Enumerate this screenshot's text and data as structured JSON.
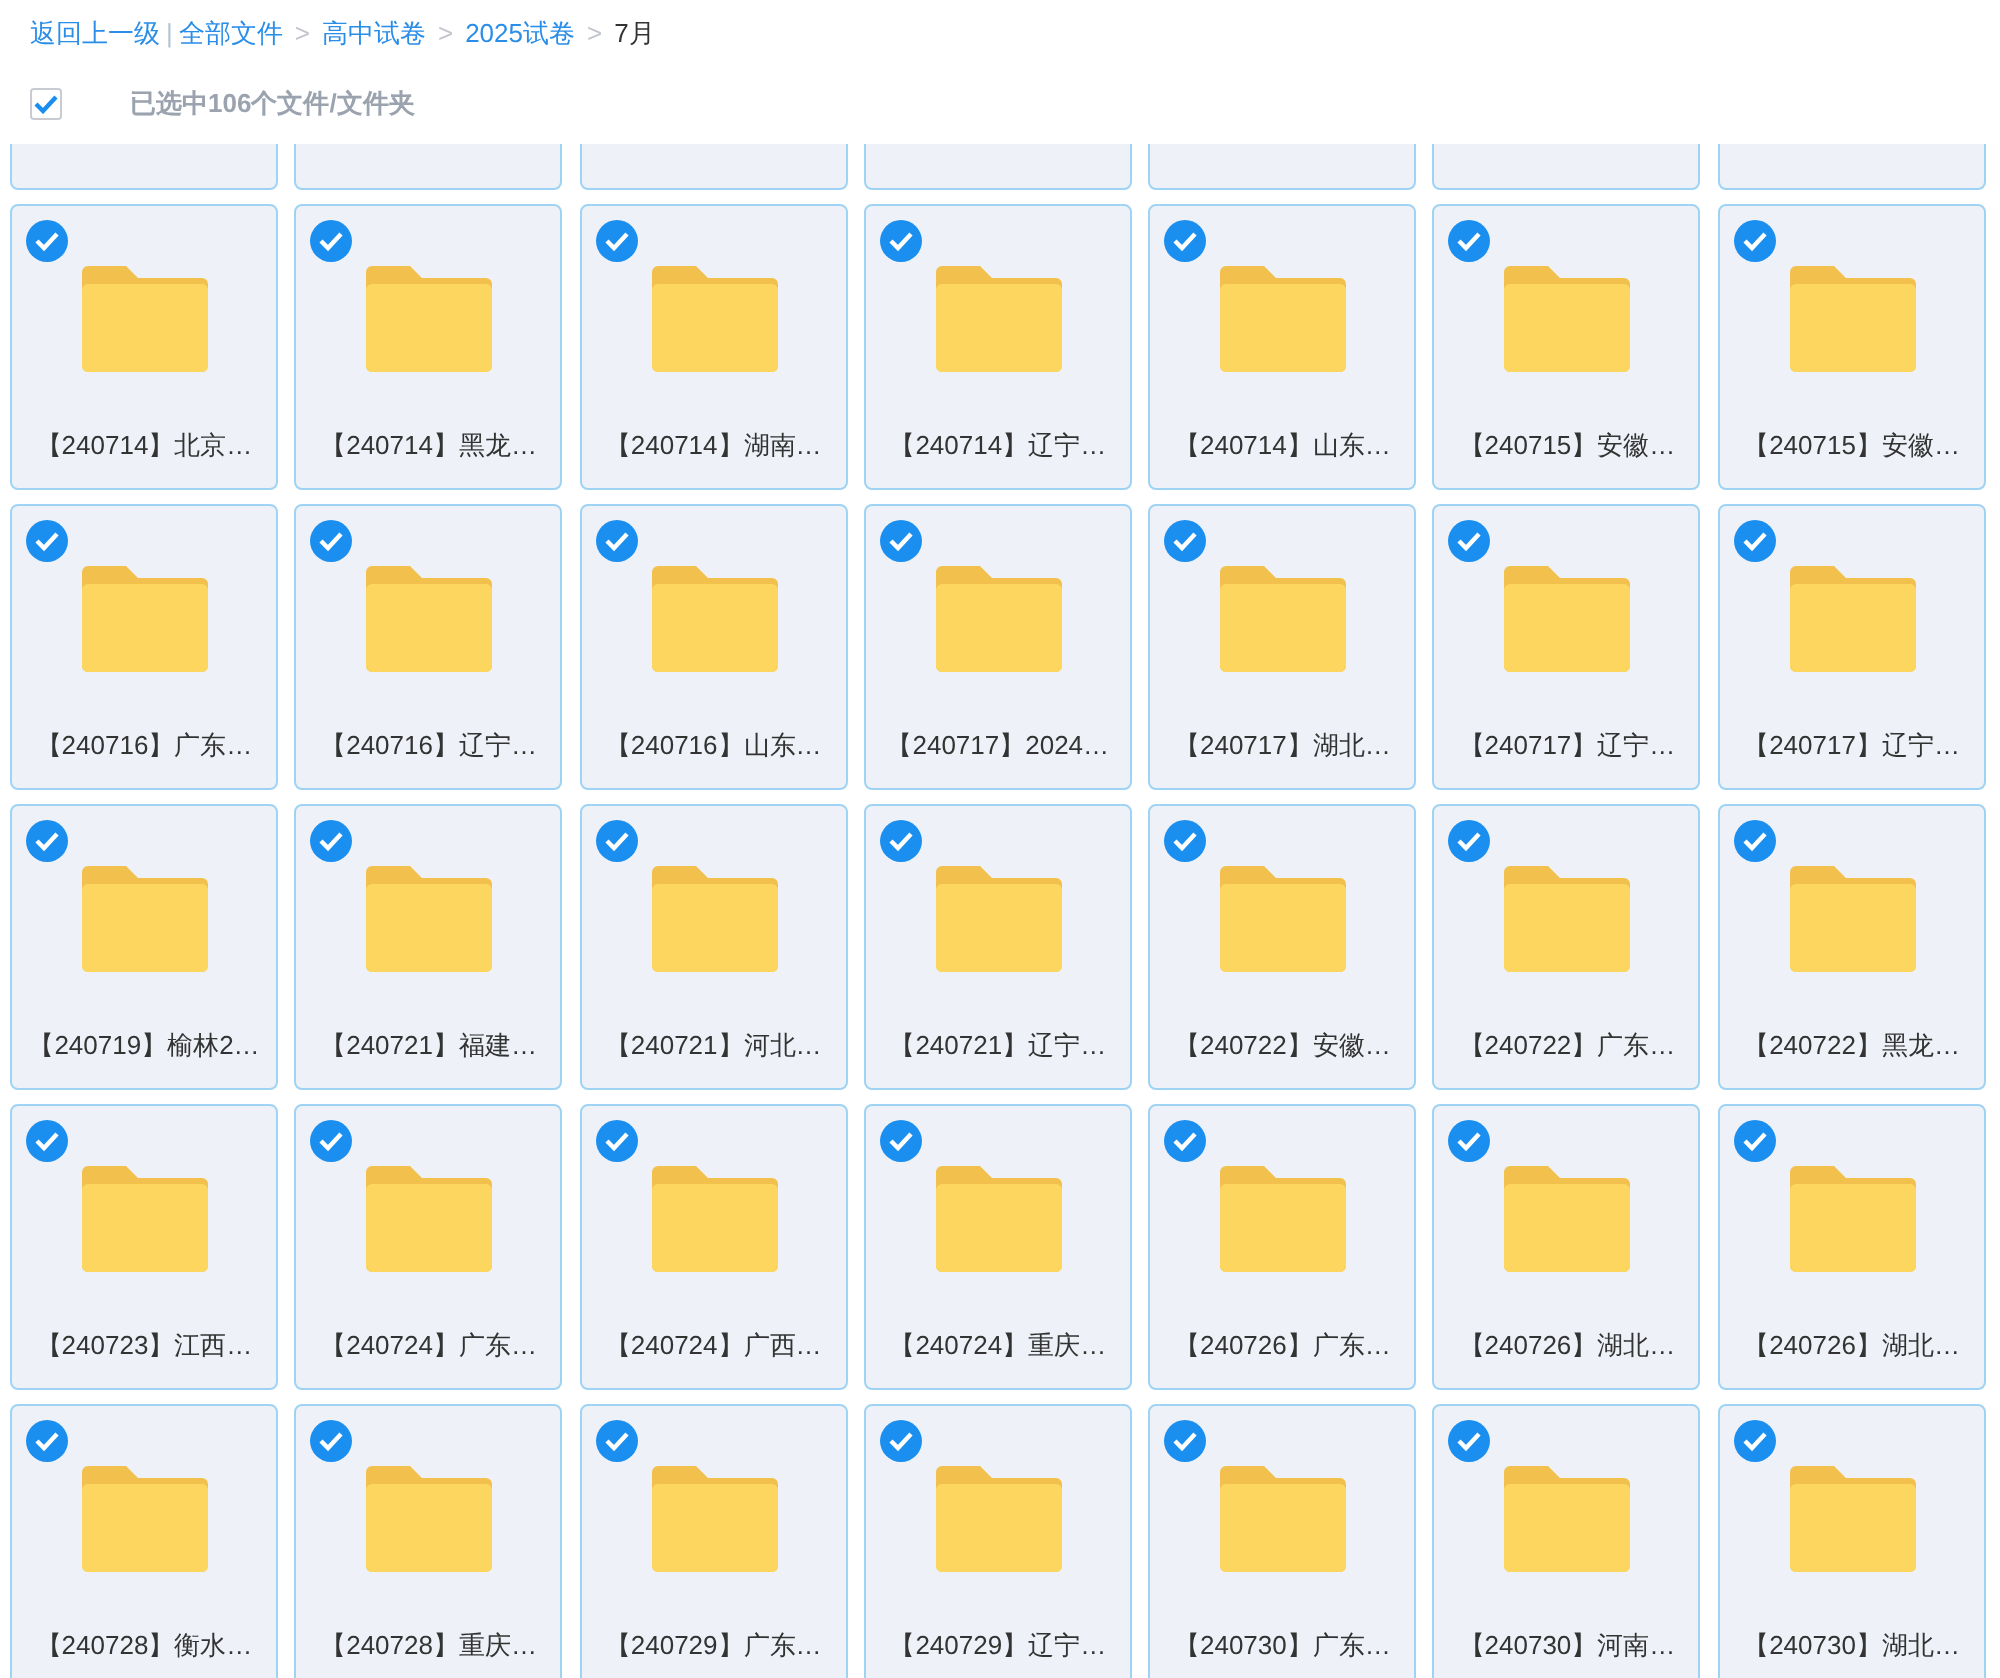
{
  "breadcrumb": {
    "back": "返回上一级",
    "divider": "|",
    "separator": ">",
    "items": [
      {
        "label": "全部文件",
        "current": false
      },
      {
        "label": "高中试卷",
        "current": false
      },
      {
        "label": "2025试卷",
        "current": false
      },
      {
        "label": "7月",
        "current": true
      }
    ]
  },
  "selection": {
    "checked": true,
    "text": "已选中106个文件/文件夹"
  },
  "cut_off_row": [
    {
      "kind": "folder"
    },
    {
      "kind": "folder"
    },
    {
      "kind": "folder"
    },
    {
      "kind": "folder"
    },
    {
      "kind": "folder"
    },
    {
      "kind": "folder"
    },
    {
      "kind": "folder"
    }
  ],
  "folders": [
    {
      "name": "【240714】北京…",
      "selected": true
    },
    {
      "name": "【240714】黑龙…",
      "selected": true
    },
    {
      "name": "【240714】湖南…",
      "selected": true
    },
    {
      "name": "【240714】辽宁…",
      "selected": true
    },
    {
      "name": "【240714】山东…",
      "selected": true
    },
    {
      "name": "【240715】安徽…",
      "selected": true
    },
    {
      "name": "【240715】安徽…",
      "selected": true
    },
    {
      "name": "【240716】广东…",
      "selected": true
    },
    {
      "name": "【240716】辽宁…",
      "selected": true
    },
    {
      "name": "【240716】山东…",
      "selected": true
    },
    {
      "name": "【240717】2024…",
      "selected": true
    },
    {
      "name": "【240717】湖北…",
      "selected": true
    },
    {
      "name": "【240717】辽宁…",
      "selected": true
    },
    {
      "name": "【240717】辽宁…",
      "selected": true
    },
    {
      "name": "【240719】榆林2…",
      "selected": true
    },
    {
      "name": "【240721】福建…",
      "selected": true
    },
    {
      "name": "【240721】河北…",
      "selected": true
    },
    {
      "name": "【240721】辽宁…",
      "selected": true
    },
    {
      "name": "【240722】安徽…",
      "selected": true
    },
    {
      "name": "【240722】广东…",
      "selected": true
    },
    {
      "name": "【240722】黑龙…",
      "selected": true
    },
    {
      "name": "【240723】江西…",
      "selected": true
    },
    {
      "name": "【240724】广东…",
      "selected": true
    },
    {
      "name": "【240724】广西…",
      "selected": true
    },
    {
      "name": "【240724】重庆…",
      "selected": true
    },
    {
      "name": "【240726】广东…",
      "selected": true
    },
    {
      "name": "【240726】湖北…",
      "selected": true
    },
    {
      "name": "【240726】湖北…",
      "selected": true
    },
    {
      "name": "【240728】衡水…",
      "selected": true
    },
    {
      "name": "【240728】重庆…",
      "selected": true
    },
    {
      "name": "【240729】广东…",
      "selected": true
    },
    {
      "name": "【240729】辽宁…",
      "selected": true
    },
    {
      "name": "【240730】广东…",
      "selected": true
    },
    {
      "name": "【240730】河南…",
      "selected": true
    },
    {
      "name": "【240730】湖北…",
      "selected": true
    }
  ]
}
